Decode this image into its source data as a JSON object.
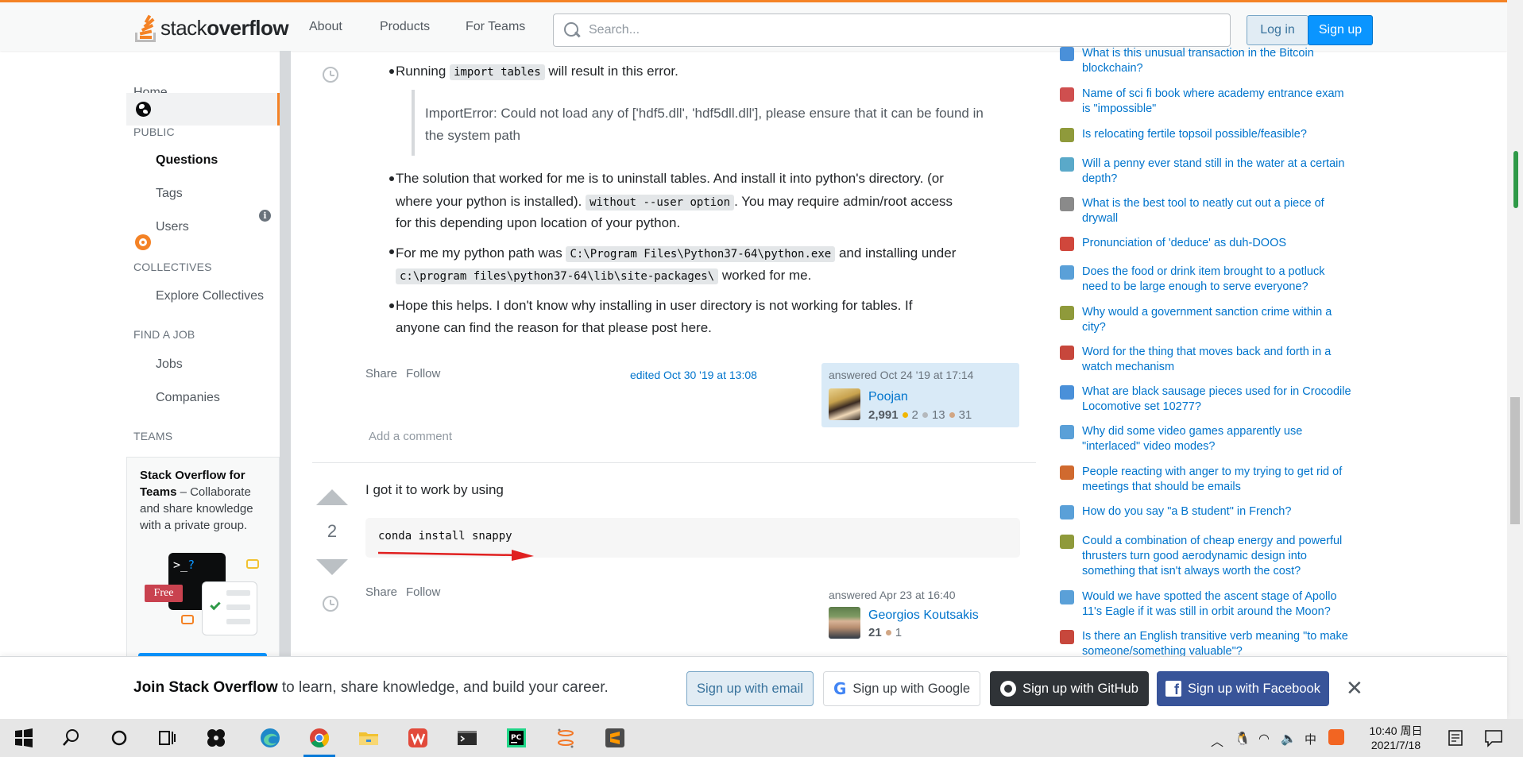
{
  "topbar": {
    "logo_prefix": "stack",
    "logo_suffix": "overflow",
    "nav": [
      "About",
      "Products",
      "For Teams"
    ],
    "search_placeholder": "Search...",
    "login_label": "Log in",
    "signup_label": "Sign up",
    "accent_color": "#f48225"
  },
  "sidebar": {
    "home": "Home",
    "public_heading": "PUBLIC",
    "questions": "Questions",
    "tags": "Tags",
    "users": "Users",
    "collectives_heading": "COLLECTIVES",
    "explore_collectives": "Explore Collectives",
    "find_job_heading": "FIND A JOB",
    "jobs": "Jobs",
    "companies": "Companies",
    "teams_heading": "TEAMS",
    "teams_card": {
      "title": "Stack Overflow for Teams",
      "body": " – Collaborate and share knowledge with a private group.",
      "free_badge": "Free",
      "terminal_prompt": ">_",
      "terminal_q": "?"
    }
  },
  "answer1": {
    "bullets": {
      "b1_pre": "Running ",
      "b1_code": "import tables",
      "b1_post": " will result in this error.",
      "quote": "ImportError: Could not load any of ['hdf5.dll', 'hdf5dll.dll'], please ensure that it can be found in the system path",
      "b2_line1": "The solution that worked for me is to uninstall tables. And install it into python's directory. (or",
      "b2_line2_pre": "where your python is installed). ",
      "b2_code": "without --user option",
      "b2_line2_post": ". You may require admin/root access",
      "b2_line3": "for this depending upon location of your python.",
      "b3_pre": "For me my python path was ",
      "b3_code1": "C:\\Program Files\\Python37-64\\python.exe",
      "b3_mid": " and installing under",
      "b3_code2": "c:\\program files\\python37-64\\lib\\site-packages\\",
      "b3_post": " worked for me.",
      "b4_line1": "Hope this helps. I don't know why installing in user directory is not working for tables. If",
      "b4_line2": "anyone can find the reason for that please post here."
    },
    "share": "Share",
    "follow": "Follow",
    "edited": "edited Oct 30 '19 at 13:08",
    "answered": "answered Oct 24 '19 at 17:14",
    "user": "Poojan",
    "reputation": "2,991",
    "gold": "2",
    "silver": "13",
    "bronze": "31",
    "add_comment": "Add a comment"
  },
  "answer2": {
    "votes": "2",
    "text": "I got it to work by using",
    "code": "conda install snappy",
    "share": "Share",
    "follow": "Follow",
    "answered": "answered Apr 23 at 16:40",
    "user": "Georgios Koutsakis",
    "reputation": "21",
    "bronze": "1"
  },
  "hot_network_questions": [
    {
      "title": "What is this unusual transaction in the Bitcoin blockchain?",
      "icon_color": "#4a90d9",
      "icon": "bitcoin-se-icon"
    },
    {
      "title": "Name of sci fi book where academy entrance exam is \"impossible\"",
      "icon_color": "#cf4f4f",
      "icon": "scifi-se-icon"
    },
    {
      "title": "Is relocating fertile topsoil possible/feasible?",
      "icon_color": "#8f9a3b",
      "icon": "gardening-se-icon"
    },
    {
      "title": "Will a penny ever stand still in the water at a certain depth?",
      "icon_color": "#5aa9c9",
      "icon": "physics-se-icon"
    },
    {
      "title": "What is the best tool to neatly cut out a piece of drywall",
      "icon_color": "#8a8a8a",
      "icon": "diy-se-icon"
    },
    {
      "title": "Pronunciation of 'deduce' as duh-DOOS",
      "icon_color": "#d0473c",
      "icon": "english-se-icon"
    },
    {
      "title": "Does the food or drink item brought to a potluck need to be large enough to serve everyone?",
      "icon_color": "#5aa0d8",
      "icon": "ipse-icon"
    },
    {
      "title": "Why would a government sanction crime within a city?",
      "icon_color": "#8f9a3b",
      "icon": "worldbuilding-se-icon"
    },
    {
      "title": "Word for the thing that moves back and forth in a watch mechanism",
      "icon_color": "#c7473c",
      "icon": "english-se-icon-2"
    },
    {
      "title": "What are black sausage pieces used for in Crocodile Locomotive set 10277?",
      "icon_color": "#4a90d9",
      "icon": "lego-se-icon"
    },
    {
      "title": "Why did some video games apparently use \"interlaced\" video modes?",
      "icon_color": "#5aa0d8",
      "icon": "retrocomputing-se-icon"
    },
    {
      "title": "People reacting with anger to my trying to get rid of meetings that should be emails",
      "icon_color": "#d06a2f",
      "icon": "workplace-se-icon"
    },
    {
      "title": "How do you say \"a B student\" in French?",
      "icon_color": "#5aa0d8",
      "icon": "french-se-icon"
    },
    {
      "title": "Could a combination of cheap energy and powerful thrusters turn good aerodynamic design into something that isn't always worth the cost?",
      "icon_color": "#8f9a3b",
      "icon": "worldbuilding-se-icon-2"
    },
    {
      "title": "Would we have spotted the ascent stage of Apollo 11's Eagle if it was still in orbit around the Moon?",
      "icon_color": "#5aa0d8",
      "icon": "space-se-icon"
    },
    {
      "title": "Is there an English transitive verb meaning \"to make someone/something valuable\"?",
      "icon_color": "#c7473c",
      "icon": "english-se-icon-3"
    }
  ],
  "banner": {
    "bold": "Join Stack Overflow",
    "rest": " to learn, share knowledge, and build your career.",
    "email": "Sign up with email",
    "google": "Sign up with Google",
    "github": "Sign up with GitHub",
    "facebook": "Sign up with Facebook"
  },
  "taskbar": {
    "time": "10:40 周日",
    "date": "2021/7/18",
    "ime": "中",
    "accent_color": "#0078d7"
  }
}
